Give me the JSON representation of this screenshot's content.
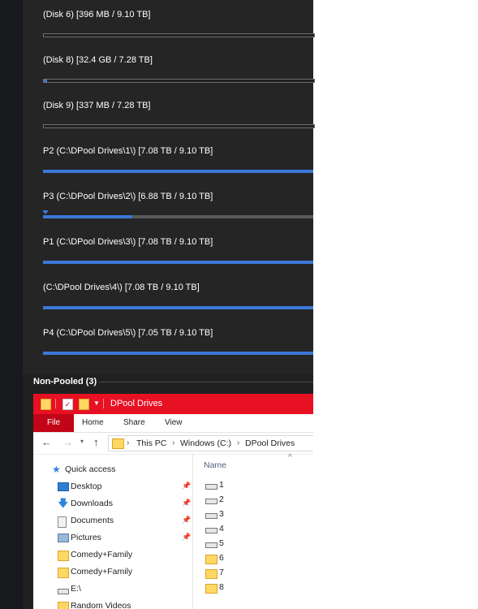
{
  "disks": [
    {
      "label": "(Disk 6) [396 MB / 9.10 TB]",
      "fill": 0.0,
      "style": "empty"
    },
    {
      "label": "(Disk 8) [32.4 GB / 7.28 TB]",
      "fill": 0.013,
      "style": "empty"
    },
    {
      "label": "(Disk 9) [337 MB / 7.28 TB]",
      "fill": 0.0,
      "style": "empty"
    },
    {
      "label": "P2 (C:\\DPool Drives\\1\\) [7.08 TB / 9.10 TB]",
      "fill": 1.0,
      "style": "full"
    },
    {
      "label": "P3 (C:\\DPool Drives\\2\\) [6.88 TB / 9.10 TB]",
      "fill": 0.33,
      "style": "partial"
    },
    {
      "label": "P1 (C:\\DPool Drives\\3\\) [7.08 TB / 9.10 TB]",
      "fill": 1.0,
      "style": "full"
    },
    {
      "label": "(C:\\DPool Drives\\4\\) [7.08 TB / 9.10 TB]",
      "fill": 1.0,
      "style": "full"
    },
    {
      "label": "P4 (C:\\DPool Drives\\5\\) [7.05 TB / 9.10 TB]",
      "fill": 1.0,
      "style": "full"
    }
  ],
  "section": {
    "title": "Non-Pooled (3)"
  },
  "explorer": {
    "title": "DPool Drives",
    "tabs": [
      "File",
      "Home",
      "Share",
      "View"
    ],
    "breadcrumb": [
      "This PC",
      "Windows (C:)",
      "DPool Drives"
    ],
    "nav_items": [
      {
        "label": "Quick access",
        "icon": "star-icon",
        "pinned": false
      },
      {
        "label": "Desktop",
        "icon": "desktop-icon",
        "pinned": true
      },
      {
        "label": "Downloads",
        "icon": "download-arrow-icon",
        "pinned": true
      },
      {
        "label": "Documents",
        "icon": "documents-icon",
        "pinned": true
      },
      {
        "label": "Pictures",
        "icon": "pictures-icon",
        "pinned": true
      },
      {
        "label": "Comedy+Family",
        "icon": "folder-icon",
        "pinned": false
      },
      {
        "label": "Comedy+Family",
        "icon": "folder-icon",
        "pinned": false
      },
      {
        "label": "E:\\",
        "icon": "drive-icon",
        "pinned": false
      },
      {
        "label": "Random Videos",
        "icon": "folder-icon",
        "pinned": false
      }
    ],
    "column_header": "Name",
    "files": [
      {
        "name": "1",
        "type": "drive"
      },
      {
        "name": "2",
        "type": "drive"
      },
      {
        "name": "3",
        "type": "drive"
      },
      {
        "name": "4",
        "type": "drive"
      },
      {
        "name": "5",
        "type": "drive"
      },
      {
        "name": "6",
        "type": "folder"
      },
      {
        "name": "7",
        "type": "folder"
      },
      {
        "name": "8",
        "type": "folder"
      }
    ]
  },
  "colors": {
    "accent_bar": "#3b78d8",
    "title_bar": "#e81123",
    "file_tab": "#c10417"
  }
}
